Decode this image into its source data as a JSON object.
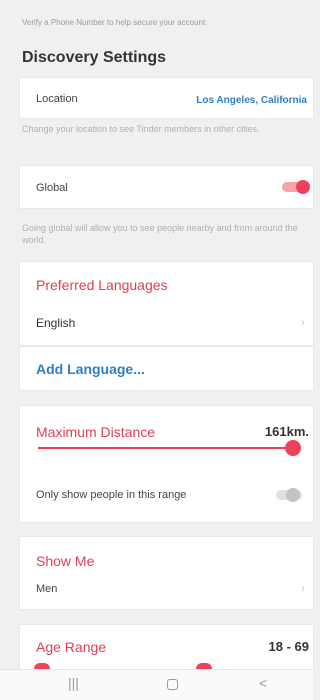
{
  "top_hint": "Verify a Phone Number to help secure your account.",
  "section_title": "Discovery Settings",
  "location": {
    "label": "Location",
    "value": "Los Angeles, California",
    "hint": "Change your location to see Tinder members in other cities."
  },
  "global": {
    "label": "Global",
    "enabled": true,
    "hint": "Going global will allow you to see people nearby and from around the world."
  },
  "preferred_languages": {
    "title": "Preferred Languages",
    "items": [
      {
        "label": "English"
      }
    ],
    "add_label": "Add Language..."
  },
  "max_distance": {
    "title": "Maximum Distance",
    "value": "161km.",
    "slider_fraction": 1.0,
    "range_only_label": "Only show people in this range",
    "range_only_enabled": false
  },
  "show_me": {
    "title": "Show Me",
    "value": "Men"
  },
  "age_range": {
    "title": "Age Range",
    "value": "18 - 69"
  },
  "colors": {
    "accent": "#e13e55",
    "link": "#2f7fc1"
  },
  "icons": {
    "chevron": "chevron-right-icon",
    "nav_recents": "recents-icon",
    "nav_home": "home-icon",
    "nav_back": "back-icon"
  },
  "nav": {
    "recents": "|||",
    "back": "<"
  }
}
